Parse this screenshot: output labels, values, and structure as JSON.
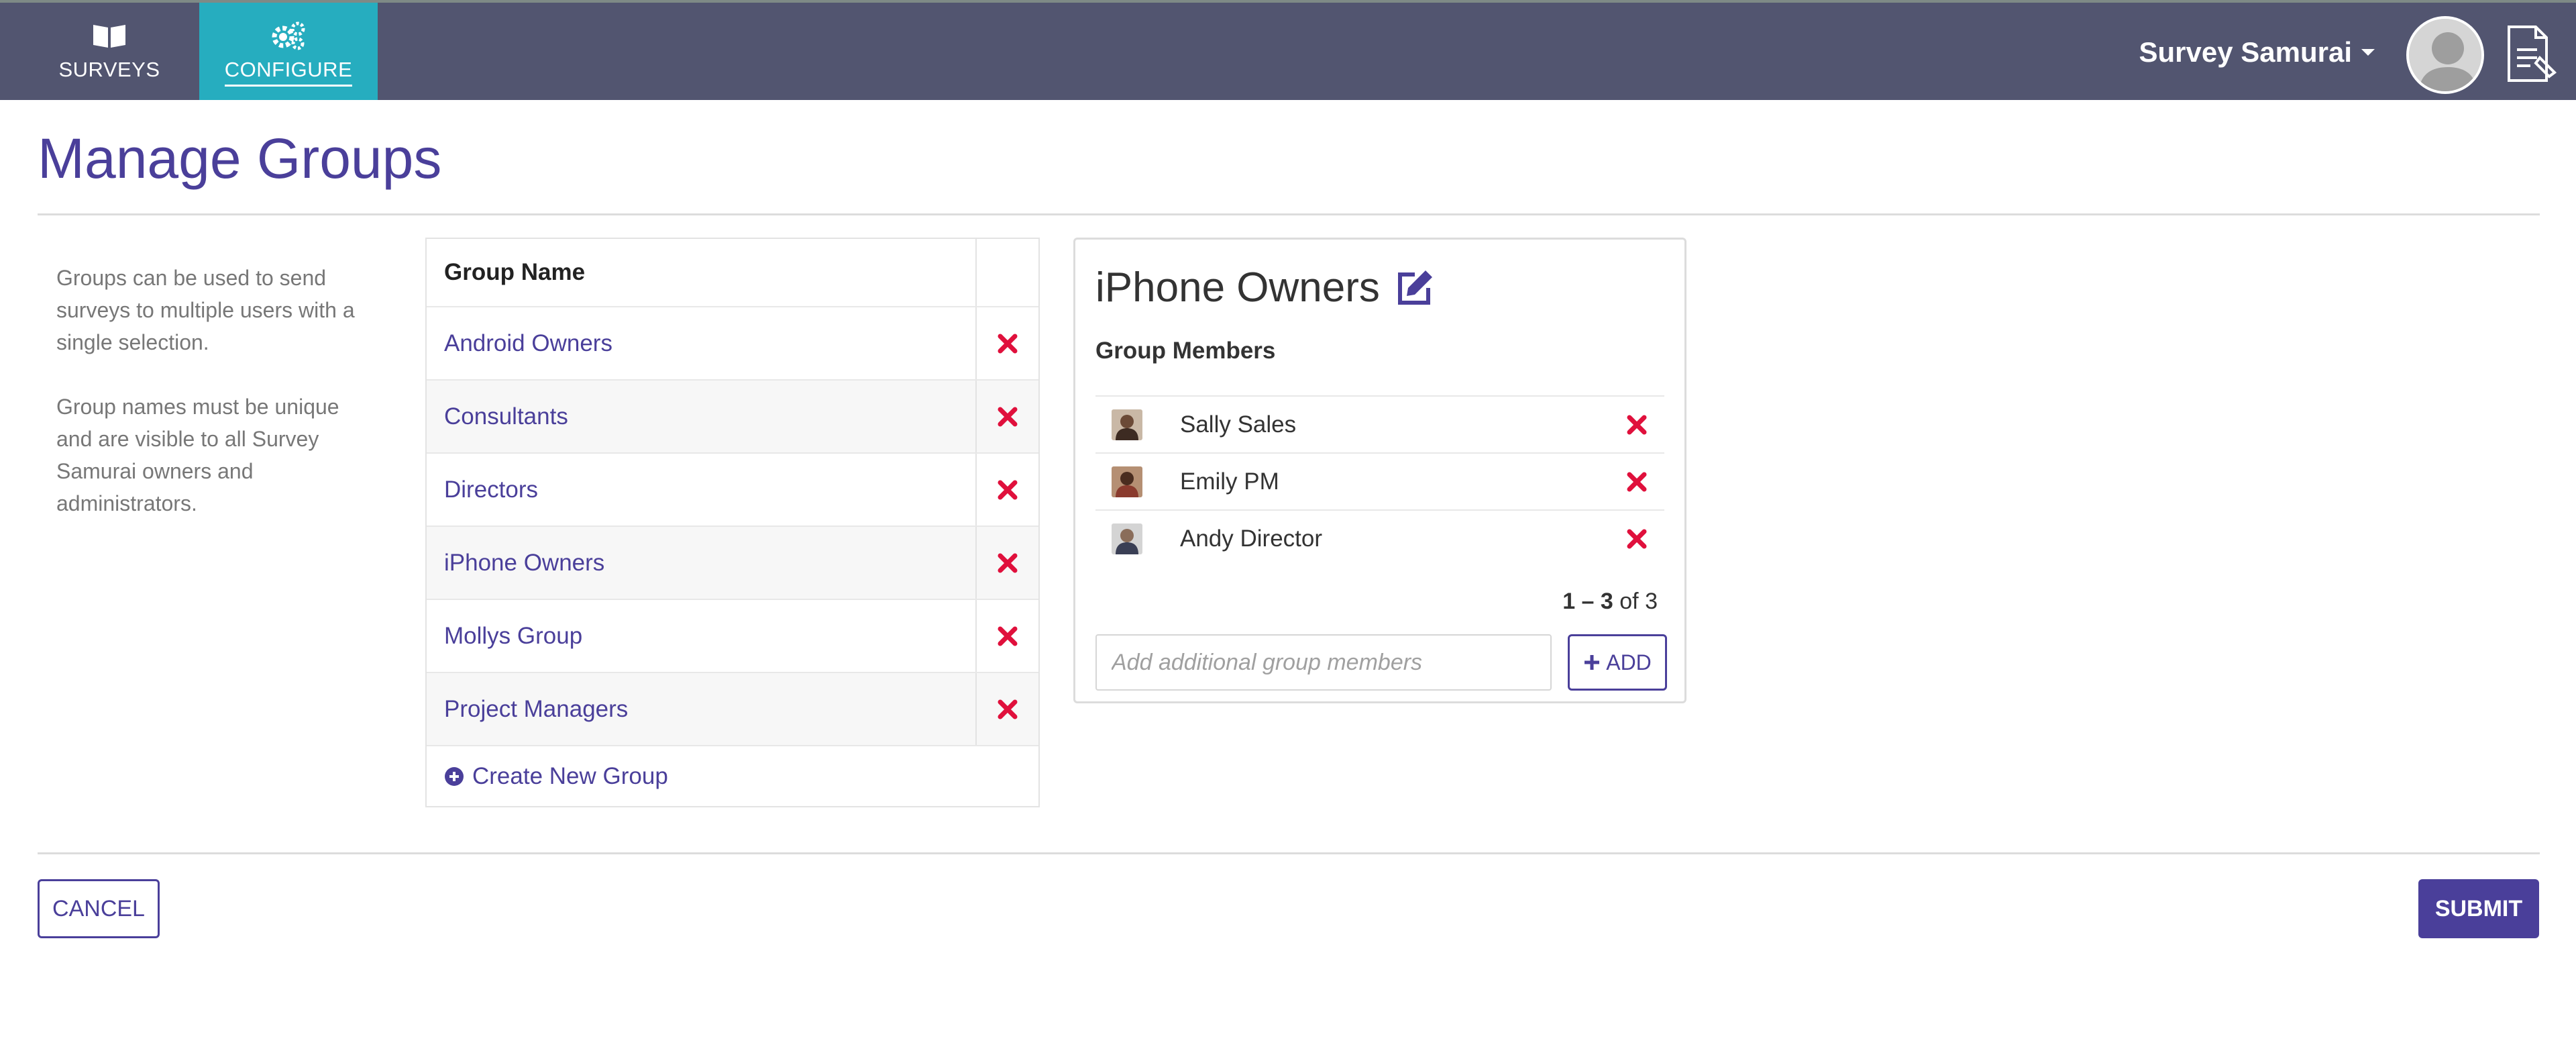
{
  "nav": {
    "tabs": [
      {
        "label": "SURVEYS",
        "icon": "book-icon",
        "active": false
      },
      {
        "label": "CONFIGURE",
        "icon": "gears-icon",
        "active": true
      }
    ],
    "user_name": "Survey Samurai"
  },
  "page": {
    "title": "Manage Groups",
    "description": [
      "Groups can be used to send surveys to multiple users with a single selection.",
      "Group names must be unique and are visible to all Survey Samurai owners and administrators."
    ]
  },
  "groups_table": {
    "header": "Group Name",
    "rows": [
      {
        "name": "Android Owners"
      },
      {
        "name": "Consultants"
      },
      {
        "name": "Directors"
      },
      {
        "name": "iPhone Owners"
      },
      {
        "name": "Mollys Group"
      },
      {
        "name": "Project Managers"
      }
    ],
    "create_label": "Create New Group"
  },
  "detail": {
    "title": "iPhone Owners",
    "members_label": "Group Members",
    "members": [
      {
        "name": "Sally Sales"
      },
      {
        "name": "Emily PM"
      },
      {
        "name": "Andy Director"
      }
    ],
    "pagination": {
      "range": "1 – 3",
      "of_label": "of",
      "total": "3"
    },
    "add_placeholder": "Add additional group members",
    "add_label": "ADD"
  },
  "footer": {
    "cancel_label": "CANCEL",
    "submit_label": "SUBMIT"
  },
  "colors": {
    "nav_bg": "#525570",
    "active_tab": "#26adbf",
    "accent": "#4a3f9a",
    "delete": "#e0103c"
  }
}
